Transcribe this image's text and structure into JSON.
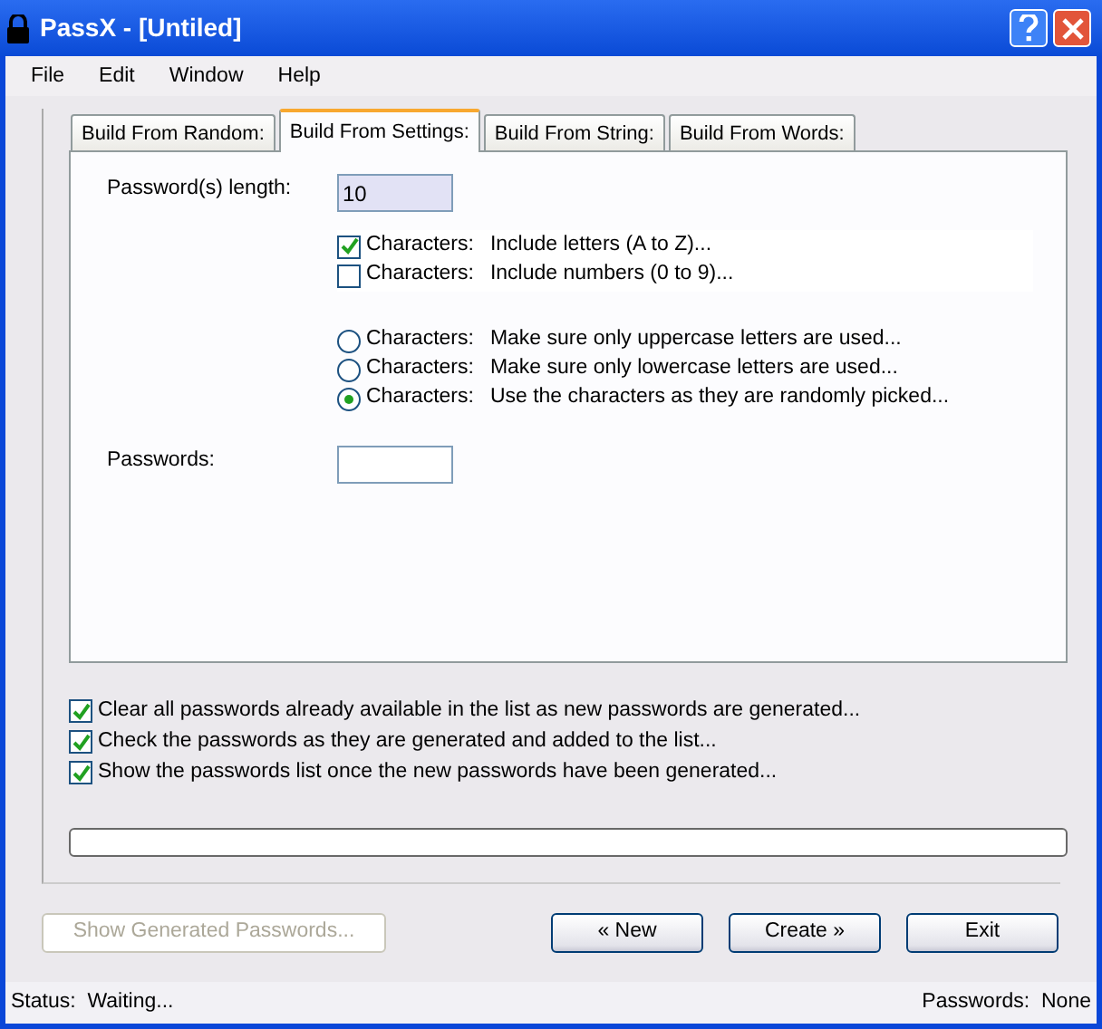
{
  "window": {
    "title": "PassX - [Untiled]"
  },
  "menu": [
    "File",
    "Edit",
    "Window",
    "Help"
  ],
  "tabs": [
    {
      "label": "Build From Random:",
      "selected": false
    },
    {
      "label": "Build From Settings:",
      "selected": true
    },
    {
      "label": "Build From String:",
      "selected": false
    },
    {
      "label": "Build From Words:",
      "selected": false
    }
  ],
  "length": {
    "label": "Password(s) length:",
    "value": "10"
  },
  "character_options": [
    {
      "kind": "checkbox",
      "prefix": "Characters:",
      "label": "Include letters (A to Z)...",
      "checked": true
    },
    {
      "kind": "checkbox",
      "prefix": "Characters:",
      "label": "Include numbers (0 to 9)...",
      "checked": false
    }
  ],
  "case_options": [
    {
      "prefix": "Characters:",
      "label": "Make sure only uppercase letters are used...",
      "selected": false
    },
    {
      "prefix": "Characters:",
      "label": "Make sure only lowercase letters are used...",
      "selected": false
    },
    {
      "prefix": "Characters:",
      "label": "Use the characters as they are randomly picked...",
      "selected": true
    }
  ],
  "passwords": {
    "label": "Passwords:"
  },
  "options": [
    {
      "label": "Clear all passwords already available in the list as new passwords are generated...",
      "checked": true
    },
    {
      "label": "Check the passwords as they are generated and added to the list...",
      "checked": true
    },
    {
      "label": "Show the passwords list once the new passwords have been generated...",
      "checked": true
    }
  ],
  "progress": {
    "level": 0
  },
  "buttons": [
    {
      "label": "Show Generated Passwords...",
      "disabled": true
    },
    {
      "label": "« New",
      "disabled": false
    },
    {
      "label": "Create »",
      "disabled": false
    },
    {
      "label": "Exit",
      "disabled": false
    }
  ],
  "status_bar": {
    "status_label": "Status:",
    "status": "Waiting...",
    "count_label": "Passwords:",
    "count": "None"
  }
}
